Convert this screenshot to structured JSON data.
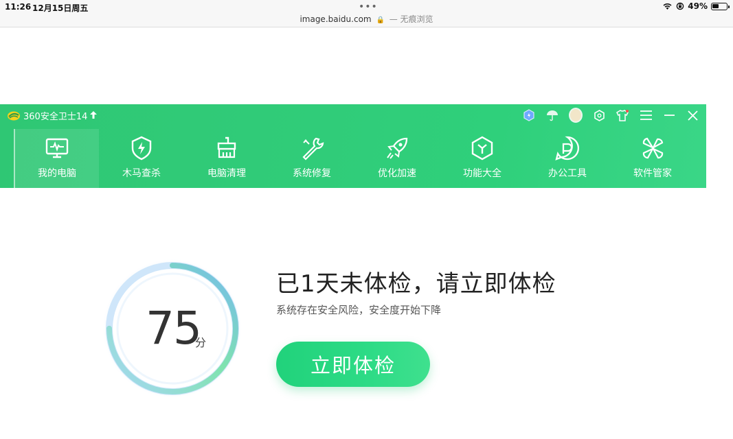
{
  "status_bar": {
    "time": "11:26",
    "date": "12月15日周五",
    "dots": "•••",
    "url": "image.baidu.com",
    "private_label": "— 无痕浏览",
    "battery": "49%",
    "icons": [
      "wifi-icon",
      "orientation-lock-icon",
      "battery-icon"
    ]
  },
  "app": {
    "title": "360安全卫士14",
    "upgrade_glyph": "🠅",
    "controls": [
      "shield-badge-icon",
      "umbrella-icon",
      "avatar",
      "settings-icon",
      "skin-icon",
      "menu-icon",
      "minimize-icon",
      "close-icon"
    ],
    "nav": [
      {
        "label": "我的电脑",
        "icon": "monitor-icon"
      },
      {
        "label": "木马查杀",
        "icon": "shield-bolt-icon"
      },
      {
        "label": "电脑清理",
        "icon": "broom-icon"
      },
      {
        "label": "系统修复",
        "icon": "wrench-icon"
      },
      {
        "label": "优化加速",
        "icon": "rocket-icon"
      },
      {
        "label": "功能大全",
        "icon": "cube-icon"
      },
      {
        "label": "办公工具",
        "icon": "office-icon"
      },
      {
        "label": "软件管家",
        "icon": "apps-icon"
      }
    ],
    "active_nav": "我的电脑"
  },
  "main": {
    "score": "75",
    "score_unit": "分",
    "score_level": 0.75,
    "headline": "已1天未体检，请立即体检",
    "subline": "系统存在安全风险，安全度开始下降",
    "check_button": "立即体检"
  },
  "colors": {
    "header_green": "#30cc79",
    "button_green": "#2ddb86",
    "ring_blue": "#8ec9f2",
    "ring_green": "#7fe3ae"
  }
}
